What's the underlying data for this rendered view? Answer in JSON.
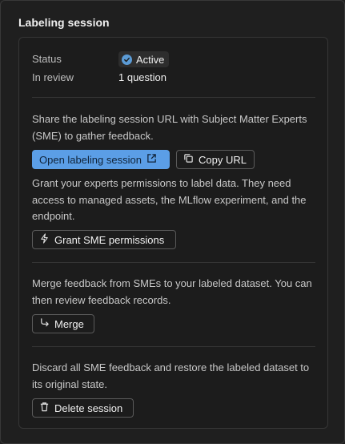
{
  "panel": {
    "title": "Labeling session"
  },
  "status": {
    "status_label": "Status",
    "status_value": "Active",
    "review_label": "In review",
    "review_value": "1 question"
  },
  "share": {
    "description": "Share the labeling session URL with Subject Matter Experts (SME) to gather feedback.",
    "open_label": "Open labeling session",
    "copy_label": "Copy URL"
  },
  "grant": {
    "description": "Grant your experts permissions to label data. They need access to managed assets, the MLflow experiment, and the endpoint.",
    "button_label": "Grant SME permissions"
  },
  "merge": {
    "description": "Merge feedback from SMEs to your labeled dataset. You can then review feedback records.",
    "button_label": "Merge"
  },
  "discard": {
    "description": "Discard all SME feedback and restore the labeled dataset to its original state.",
    "button_label": "Delete session"
  },
  "colors": {
    "background": "#1f1f1f",
    "primary_button": "#5b9ee6",
    "status_check": "#5b9bd5"
  }
}
